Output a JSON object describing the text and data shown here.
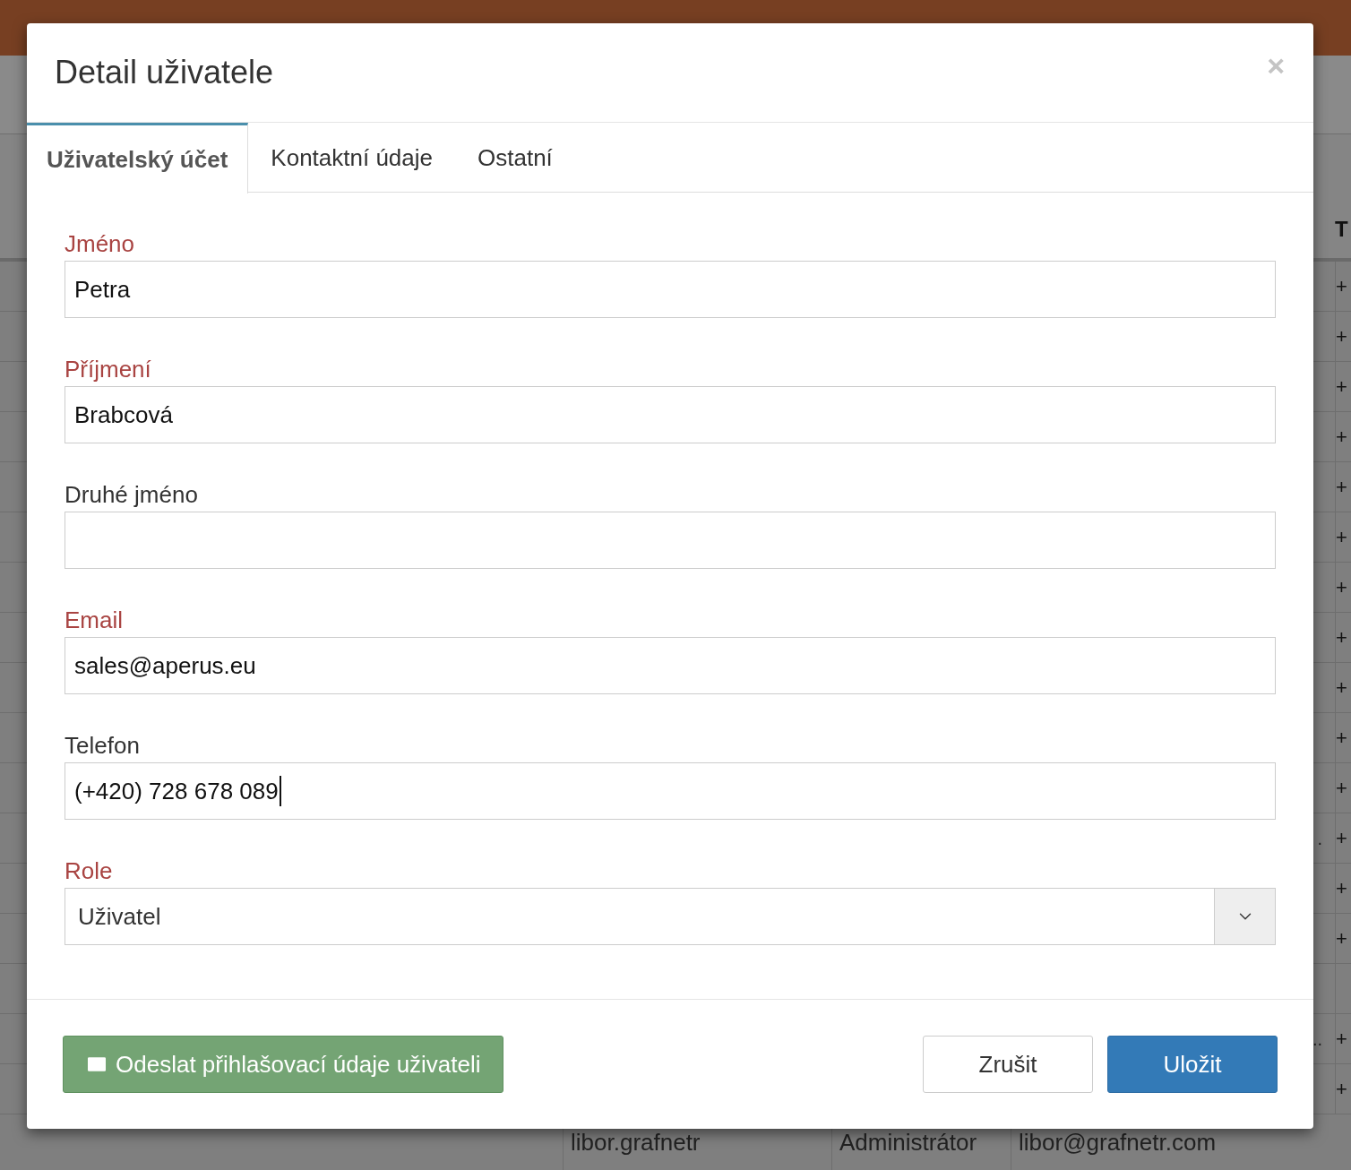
{
  "background": {
    "table_header": "T",
    "rows": [
      {
        "sign": "+"
      },
      {
        "sign": "+"
      },
      {
        "sign": "+"
      },
      {
        "sign": "+"
      },
      {
        "sign": "+"
      },
      {
        "sign": "+"
      },
      {
        "sign": "+"
      },
      {
        "sign": "+"
      },
      {
        "sign": "+"
      },
      {
        "sign": "+"
      },
      {
        "sign": "+"
      },
      {
        "sign": "+",
        "cut_text": "."
      },
      {
        "sign": "+"
      },
      {
        "sign": "+"
      },
      {},
      {
        "sign": "+",
        "cut_text": ".."
      },
      {
        "sign": "+"
      }
    ],
    "bottom_row": [
      "libor.grafnetr",
      "Administrátor",
      "libor@grafnetr.com"
    ]
  },
  "dialog": {
    "title": "Detail uživatele",
    "close": "×",
    "tabs": [
      {
        "label": "Uživatelský účet",
        "selected": true
      },
      {
        "label": "Kontaktní údaje",
        "selected": false
      },
      {
        "label": "Ostatní",
        "selected": false
      }
    ],
    "fields": [
      {
        "kind": "text",
        "label": "Jméno",
        "required": true,
        "value": "Petra"
      },
      {
        "kind": "text",
        "label": "Příjmení",
        "required": true,
        "value": "Brabcová"
      },
      {
        "kind": "text",
        "label": "Druhé jméno",
        "required": false
      },
      {
        "kind": "text",
        "label": "Email",
        "required": true,
        "value": "sales@aperus.eu"
      },
      {
        "kind": "text",
        "label": "Telefon",
        "required": false,
        "value": "(+420) 728 678 089",
        "focused": true
      },
      {
        "kind": "select",
        "label": "Role",
        "required": true,
        "value": "Uživatel"
      }
    ],
    "buttons": [
      {
        "kind": "success",
        "label": "Odeslat přihlašovací údaje uživateli"
      },
      {
        "kind": "default",
        "label": "Zrušit"
      },
      {
        "kind": "primary",
        "label": "Uložit"
      }
    ]
  }
}
